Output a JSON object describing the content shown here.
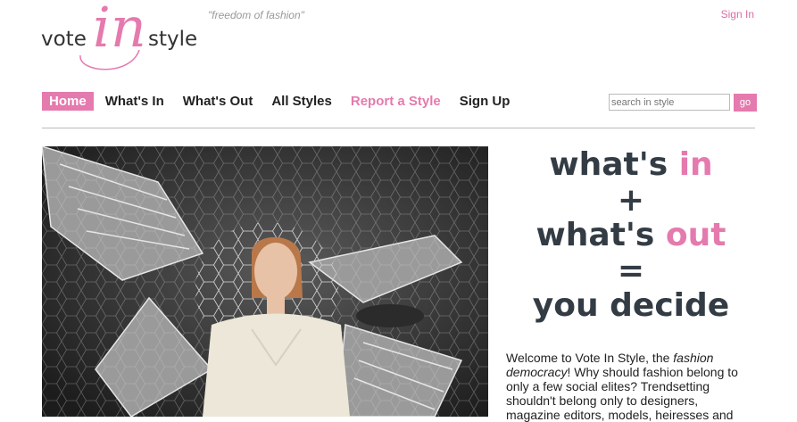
{
  "logo": {
    "left": "vote",
    "middle": "in",
    "right": "style"
  },
  "tagline": "\"freedom of fashion\"",
  "header": {
    "signin": "Sign In"
  },
  "nav": {
    "items": [
      {
        "label": "Home"
      },
      {
        "label": "What's In"
      },
      {
        "label": "What's Out"
      },
      {
        "label": "All Styles"
      },
      {
        "label": "Report a Style"
      },
      {
        "label": "Sign Up"
      }
    ]
  },
  "search": {
    "placeholder": "search in style",
    "button": "go"
  },
  "slogan": {
    "line1_a": "what's ",
    "line1_b": "in",
    "line2": "+",
    "line3_a": "what's ",
    "line3_b": "out",
    "line4": "=",
    "line5": "you decide"
  },
  "welcome": {
    "p1": "Welcome to Vote In Style, the ",
    "em1": "fashion democracy",
    "p2": "! Why should fashion belong to only a few social elites? Trendsetting shouldn't belong only to designers, magazine editors, models, heiresses and"
  },
  "colors": {
    "accent": "#e57aae",
    "text": "#333c44"
  }
}
